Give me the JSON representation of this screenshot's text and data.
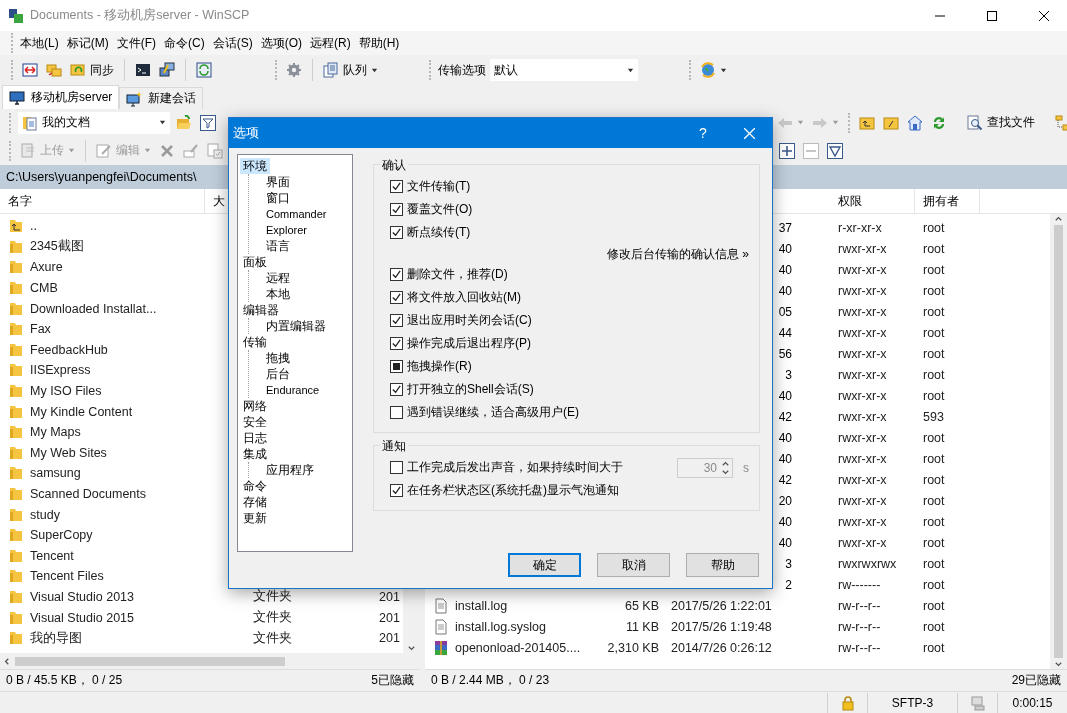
{
  "window": {
    "title": "Documents - 移动机房server - WinSCP"
  },
  "menu": [
    "本地(L)",
    "标记(M)",
    "文件(F)",
    "命令(C)",
    "会话(S)",
    "选项(O)",
    "远程(R)",
    "帮助(H)"
  ],
  "toolbar": {
    "sync_label": "同步",
    "queue_label": "队列",
    "transfer_label": "传输选项",
    "transfer_value": "默认"
  },
  "session_tabs": [
    {
      "label": "移动机房server",
      "kind": "session",
      "selected": true
    },
    {
      "label": "新建会话",
      "kind": "new",
      "selected": false
    }
  ],
  "local_panel": {
    "location": "我的文档",
    "actions": [
      "上传",
      "编辑"
    ],
    "path": "C:\\Users\\yuanpengfei\\Documents\\",
    "columns": [
      "名字",
      "大"
    ],
    "rows": [
      {
        "name": "..",
        "kind": "parent"
      },
      {
        "name": "2345截图",
        "kind": "folder"
      },
      {
        "name": "Axure",
        "kind": "folder"
      },
      {
        "name": "CMB",
        "kind": "folder"
      },
      {
        "name": "Downloaded Installat...",
        "kind": "folder"
      },
      {
        "name": "Fax",
        "kind": "folder"
      },
      {
        "name": "FeedbackHub",
        "kind": "folder"
      },
      {
        "name": "IISExpress",
        "kind": "folder"
      },
      {
        "name": "My ISO Files",
        "kind": "folder"
      },
      {
        "name": "My Kindle Content",
        "kind": "folder"
      },
      {
        "name": "My Maps",
        "kind": "folder"
      },
      {
        "name": "My Web Sites",
        "kind": "folder"
      },
      {
        "name": "samsung",
        "kind": "folder"
      },
      {
        "name": "Scanned Documents",
        "kind": "folder"
      },
      {
        "name": "study",
        "kind": "folder"
      },
      {
        "name": "SuperCopy",
        "kind": "folder"
      },
      {
        "name": "Tencent",
        "kind": "folder"
      },
      {
        "name": "Tencent Files",
        "kind": "folder"
      },
      {
        "name": "Visual Studio 2013",
        "kind": "folder",
        "type": "文件夹",
        "changed": "201"
      },
      {
        "name": "Visual Studio 2015",
        "kind": "folder",
        "type": "文件夹",
        "changed": "201"
      },
      {
        "name": "我的导图",
        "kind": "folder",
        "type": "文件夹",
        "changed": "201"
      }
    ],
    "status": "0 B / 45.5 KB， 0 / 25",
    "hidden": "5已隐藏"
  },
  "remote_panel": {
    "find_label": "查找文件",
    "columns": [
      "权限",
      "拥有者"
    ],
    "rows": [
      {
        "modified": "37",
        "permissions": "r-xr-xr-x",
        "owner": "root"
      },
      {
        "modified": "40",
        "permissions": "rwxr-xr-x",
        "owner": "root"
      },
      {
        "modified": "40",
        "permissions": "rwxr-xr-x",
        "owner": "root"
      },
      {
        "modified": "40",
        "permissions": "rwxr-xr-x",
        "owner": "root"
      },
      {
        "modified": "05",
        "permissions": "rwxr-xr-x",
        "owner": "root"
      },
      {
        "modified": "44",
        "permissions": "rwxr-xr-x",
        "owner": "root"
      },
      {
        "modified": "56",
        "permissions": "rwxr-xr-x",
        "owner": "root"
      },
      {
        "modified": "3",
        "permissions": "rwxr-xr-x",
        "owner": "root"
      },
      {
        "modified": "40",
        "permissions": "rwxr-xr-x",
        "owner": "root"
      },
      {
        "modified": "42",
        "permissions": "rwxr-xr-x",
        "owner": "593"
      },
      {
        "modified": "40",
        "permissions": "rwxr-xr-x",
        "owner": "root"
      },
      {
        "modified": "40",
        "permissions": "rwxr-xr-x",
        "owner": "root"
      },
      {
        "modified": "42",
        "permissions": "rwxr-xr-x",
        "owner": "root"
      },
      {
        "modified": "20",
        "permissions": "rwxr-xr-x",
        "owner": "root"
      },
      {
        "modified": "40",
        "permissions": "rwxr-xr-x",
        "owner": "root"
      },
      {
        "modified": "40",
        "permissions": "rwxr-xr-x",
        "owner": "root"
      },
      {
        "modified": "3",
        "permissions": "rwxrwxrwx",
        "owner": "root"
      },
      {
        "modified": "2",
        "permissions": "rw-------",
        "owner": "root"
      },
      {
        "name": "install.log",
        "kind": "file",
        "size": "65 KB",
        "modified": "2017/5/26 1:22:01",
        "permissions": "rw-r--r--",
        "owner": "root"
      },
      {
        "name": "install.log.syslog",
        "kind": "file",
        "size": "11 KB",
        "modified": "2017/5/26 1:19:48",
        "permissions": "rw-r--r--",
        "owner": "root"
      },
      {
        "name": "openonload-201405....",
        "kind": "archive",
        "size": "2,310 KB",
        "modified": "2014/7/26 0:26:12",
        "permissions": "rw-r--r--",
        "owner": "root"
      }
    ],
    "status": "0 B / 2.44 MB， 0 / 23",
    "hidden": "29已隐藏"
  },
  "dialog": {
    "title": "选项",
    "help": "?",
    "tree": [
      {
        "label": "环境",
        "selected": true,
        "children": [
          {
            "label": "界面",
            "selected": false
          },
          {
            "label": "窗口",
            "selected": false
          },
          {
            "label": "Commander",
            "selected": false
          },
          {
            "label": "Explorer",
            "selected": false
          },
          {
            "label": "语言",
            "selected": false
          }
        ]
      },
      {
        "label": "面板",
        "selected": false,
        "children": [
          {
            "label": "远程",
            "selected": false
          },
          {
            "label": "本地",
            "selected": false
          }
        ]
      },
      {
        "label": "编辑器",
        "selected": false,
        "children": [
          {
            "label": "内置编辑器",
            "selected": false
          }
        ]
      },
      {
        "label": "传输",
        "selected": false,
        "children": [
          {
            "label": "拖拽",
            "selected": false
          },
          {
            "label": "后台",
            "selected": false
          },
          {
            "label": "Endurance",
            "selected": false
          }
        ]
      },
      {
        "label": "网络",
        "selected": false
      },
      {
        "label": "安全",
        "selected": false
      },
      {
        "label": "日志",
        "selected": false
      },
      {
        "label": "集成",
        "selected": false,
        "children": [
          {
            "label": "应用程序",
            "selected": false
          }
        ]
      },
      {
        "label": "命令",
        "selected": false
      },
      {
        "label": "存储",
        "selected": false
      },
      {
        "label": "更新",
        "selected": false
      }
    ],
    "confirm": {
      "title": "确认",
      "items": [
        {
          "kind": "checkbox",
          "label": "文件传输(T)",
          "checked": true
        },
        {
          "kind": "checkbox",
          "label": "覆盖文件(O)",
          "checked": true
        },
        {
          "kind": "checkbox",
          "label": "断点续传(T)",
          "checked": true
        },
        {
          "kind": "link",
          "label": "修改后台传输的确认信息 »"
        },
        {
          "kind": "checkbox",
          "label": "删除文件，推荐(D)",
          "checked": true
        },
        {
          "kind": "checkbox",
          "label": "将文件放入回收站(M)",
          "checked": true
        },
        {
          "kind": "checkbox",
          "label": "退出应用时关闭会话(C)",
          "checked": true
        },
        {
          "kind": "checkbox",
          "label": "操作完成后退出程序(P)",
          "checked": true
        },
        {
          "kind": "partial",
          "label": "拖拽操作(R)",
          "checked": false
        },
        {
          "kind": "checkbox",
          "label": "打开独立的Shell会话(S)",
          "checked": true
        },
        {
          "kind": "checkbox",
          "label": "遇到错误继续，适合高级用户(E)",
          "checked": false
        }
      ]
    },
    "notify": {
      "title": "通知",
      "items": [
        {
          "kind": "duration",
          "label": "工作完成后发出声音，如果持续时间大于",
          "checked": false,
          "value": "30",
          "unit": "s",
          "disabled": true
        },
        {
          "kind": "checkbox",
          "label": "在任务栏状态区(系统托盘)显示气泡通知",
          "checked": true
        }
      ]
    },
    "buttons": [
      {
        "label": "确定",
        "default": true
      },
      {
        "label": "取消",
        "default": false
      },
      {
        "label": "帮助",
        "default": false
      }
    ]
  },
  "status_bar": {
    "protocol": "SFTP-3",
    "elapsed": "0:00:15"
  }
}
